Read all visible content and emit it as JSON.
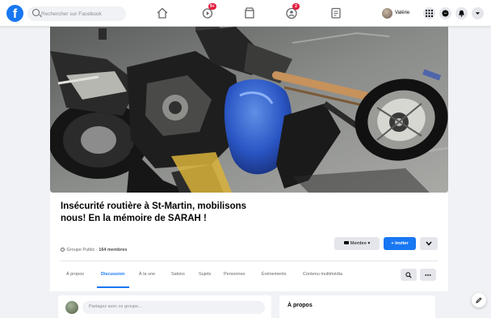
{
  "app": {
    "logo_letter": "f"
  },
  "search": {
    "placeholder": "Rechercher sur Facebook"
  },
  "nav": {
    "icons": [
      "home-icon",
      "video-icon",
      "marketplace-icon",
      "groups-icon",
      "gaming-icon"
    ],
    "video_badge": "9+",
    "groups_badge": "2"
  },
  "profile": {
    "name": "Valérie"
  },
  "group": {
    "title": "Insécurité routière à St-Martin, mobilisons nous! En la mémoire de SARAH !",
    "privacy": "Groupe Public",
    "members": "164 membres",
    "member_button": "Membre",
    "invite_button": "+ Inviter"
  },
  "tabs": [
    {
      "label": "À propos"
    },
    {
      "label": "Discussion"
    },
    {
      "label": "À la une"
    },
    {
      "label": "Salons"
    },
    {
      "label": "Sujets"
    },
    {
      "label": "Personnes"
    },
    {
      "label": "Événements"
    },
    {
      "label": "Contenu multimédia"
    }
  ],
  "active_tab": "Discussion",
  "composer": {
    "placeholder": "Partagez avec ce groupe..."
  },
  "about_card": {
    "title": "À propos"
  },
  "colors": {
    "accent": "#1877f2",
    "badge": "#e41e3f",
    "background": "#f0f2f5"
  }
}
